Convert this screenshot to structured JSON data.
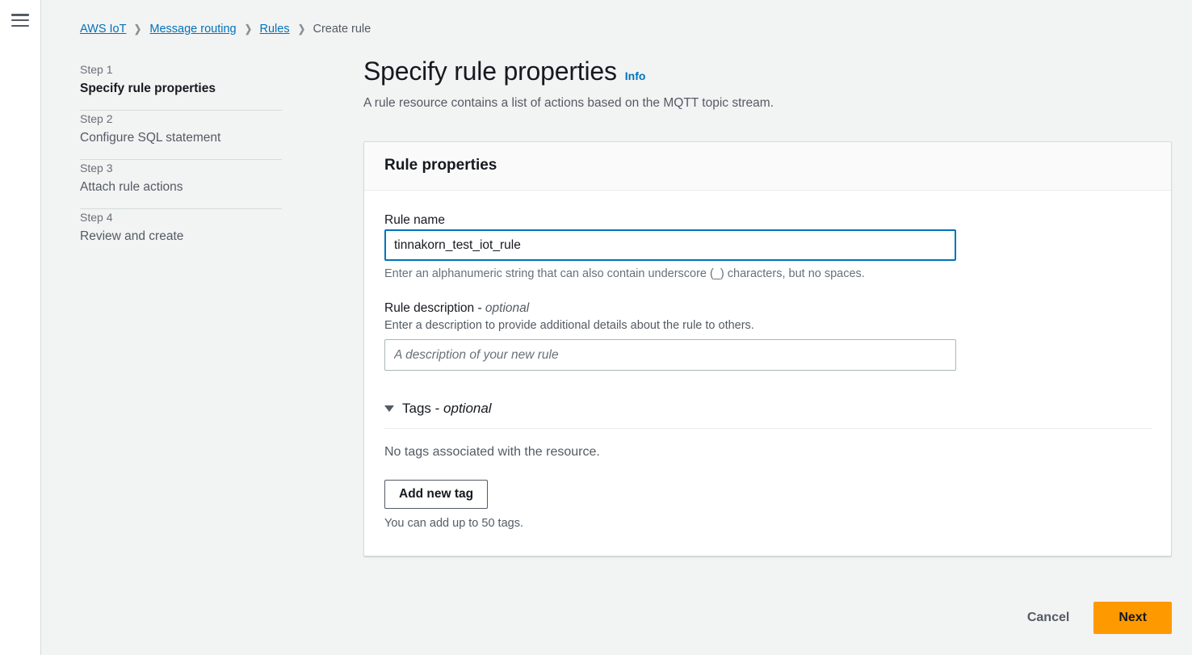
{
  "nav": {
    "menu_icon": "hamburger-menu-icon"
  },
  "breadcrumb": {
    "separator": "❯",
    "items": [
      {
        "label": "AWS IoT",
        "is_link": true
      },
      {
        "label": "Message routing",
        "is_link": true
      },
      {
        "label": "Rules",
        "is_link": true
      },
      {
        "label": "Create rule",
        "is_link": false
      }
    ]
  },
  "steps": [
    {
      "number": "Step 1",
      "title": "Specify rule properties",
      "active": true
    },
    {
      "number": "Step 2",
      "title": "Configure SQL statement",
      "active": false
    },
    {
      "number": "Step 3",
      "title": "Attach rule actions",
      "active": false
    },
    {
      "number": "Step 4",
      "title": "Review and create",
      "active": false
    }
  ],
  "header": {
    "title": "Specify rule properties",
    "info_label": "Info",
    "subtitle": "A rule resource contains a list of actions based on the MQTT topic stream."
  },
  "card": {
    "title": "Rule properties",
    "rule_name": {
      "label": "Rule name",
      "value": "tinnakorn_test_iot_rule",
      "placeholder": "",
      "hint": "Enter an alphanumeric string that can also contain underscore (_) characters, but no spaces."
    },
    "rule_description": {
      "label": "Rule description - ",
      "label_optional": "optional",
      "description": "Enter a description to provide additional details about the rule to others.",
      "value": "",
      "placeholder": "A description of your new rule"
    },
    "tags": {
      "title": "Tags - ",
      "title_optional": "optional",
      "caret_icon": "caret-down-icon",
      "empty_text": "No tags associated with the resource.",
      "add_button": "Add new tag",
      "limit_text": "You can add up to 50 tags."
    }
  },
  "footer": {
    "cancel_label": "Cancel",
    "next_label": "Next"
  },
  "colors": {
    "accent_orange": "#ff9900",
    "link_blue": "#0073bb",
    "page_bg": "#f2f3f3",
    "text_primary": "#16191f",
    "text_secondary": "#545b64"
  }
}
